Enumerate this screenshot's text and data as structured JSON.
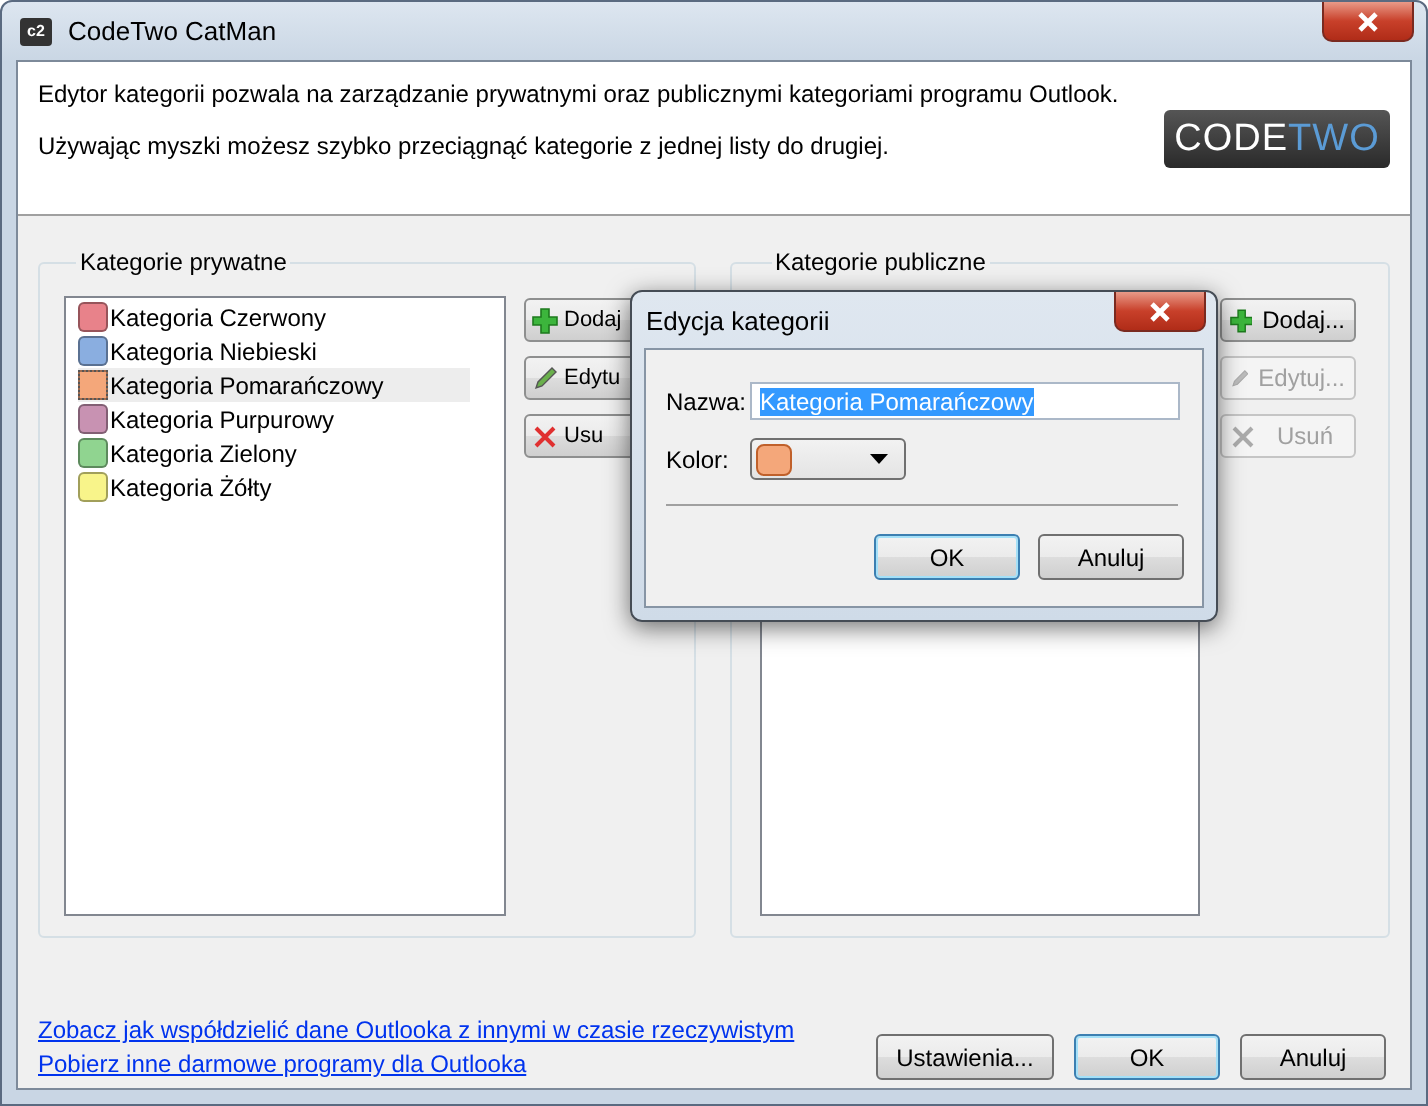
{
  "window": {
    "title": "CodeTwo CatMan",
    "icon_text": "c2"
  },
  "header": {
    "lines": [
      "Edytor kategorii pozwala na zarządzanie prywatnymi oraz publicznymi kategoriami programu Outlook.",
      "Używając myszki możesz szybko przeciągnąć kategorie z jednej listy do drugiej."
    ],
    "logo": [
      {
        "text": "CODE",
        "color": "#ffffff"
      },
      {
        "text": "TWO",
        "color": "#5b9bd5"
      }
    ]
  },
  "private": {
    "label": "Kategorie prywatne",
    "items": [
      {
        "name": "Kategoria Czerwony",
        "color": "#e8828a",
        "selected": false
      },
      {
        "name": "Kategoria Niebieski",
        "color": "#8aaee0",
        "selected": false
      },
      {
        "name": "Kategoria Pomarańczowy",
        "color": "#f4a77a",
        "selected": true
      },
      {
        "name": "Kategoria Purpurowy",
        "color": "#c892b2",
        "selected": false
      },
      {
        "name": "Kategoria Zielony",
        "color": "#90d490",
        "selected": false
      },
      {
        "name": "Kategoria Żółty",
        "color": "#f8f48a",
        "selected": false
      }
    ],
    "buttons": [
      {
        "label": "Dodaj",
        "kind": "add",
        "disabled": false
      },
      {
        "label": "Edytu",
        "kind": "edit",
        "disabled": false
      },
      {
        "label": "Usu",
        "kind": "delete",
        "disabled": false
      }
    ]
  },
  "public": {
    "label": "Kategorie publiczne",
    "buttons": [
      {
        "label": "Dodaj...",
        "kind": "add",
        "disabled": false
      },
      {
        "label": "Edytuj...",
        "kind": "edit",
        "disabled": true
      },
      {
        "label": "Usuń",
        "kind": "delete",
        "disabled": true
      }
    ]
  },
  "links": [
    "Zobacz jak współdzielić dane Outlooka z innymi w czasie rzeczywistym",
    "Pobierz inne darmowe programy dla Outlooka"
  ],
  "buttons": [
    {
      "label": "Ustawienia...",
      "default": false
    },
    {
      "label": "OK",
      "default": true
    },
    {
      "label": "Anuluj",
      "default": false
    }
  ],
  "dialog": {
    "title": "Edycja kategorii",
    "name_label": "Nazwa:",
    "name_value": "Kategoria Pomarańczowy",
    "color_label": "Kolor:",
    "color": "#f4a77a",
    "buttons": [
      {
        "label": "OK",
        "default": true
      },
      {
        "label": "Anuluj",
        "default": false
      }
    ]
  }
}
